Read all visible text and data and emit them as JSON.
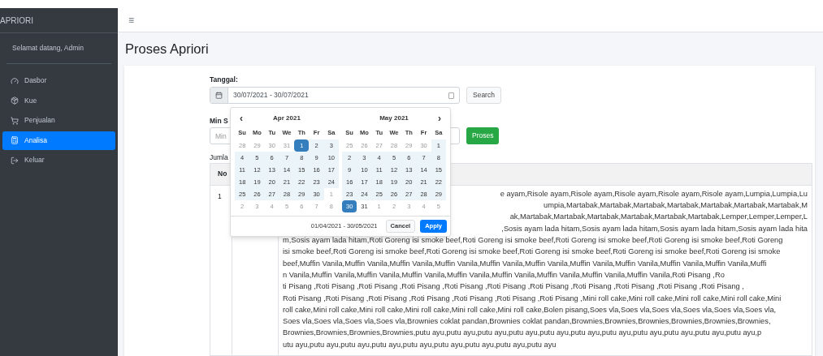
{
  "sidebar": {
    "brand": "APRIORI",
    "user": "Selamat datang, Admin",
    "items": [
      {
        "label": "Dasbor",
        "selected": false
      },
      {
        "label": "Kue",
        "selected": false
      },
      {
        "label": "Penjualan",
        "selected": false
      },
      {
        "label": "Analisa",
        "selected": true
      },
      {
        "label": "Keluar",
        "selected": false
      }
    ]
  },
  "navbar": {
    "menu": "≡"
  },
  "page_title": "Proses Apriori",
  "form": {
    "date_label": "Tanggal:",
    "date_value": "30/07/2021 - 30/07/2021",
    "search_button": "Search",
    "min_label": "Min S",
    "min_placeholder": "Min",
    "proses_button": "Proses",
    "count_label": "Jumla"
  },
  "datepicker": {
    "prev": "‹",
    "next": "›",
    "range_text": "01/04/2021 - 30/05/2021",
    "cancel": "Cancel",
    "apply": "Apply",
    "months": [
      {
        "title": "Apr 2021",
        "weekdays": [
          "Su",
          "Mo",
          "Tu",
          "We",
          "Th",
          "Fr",
          "Sa"
        ],
        "days": [
          {
            "d": "28",
            "off": true,
            "range": false,
            "selected": false
          },
          {
            "d": "29",
            "off": true,
            "range": false,
            "selected": false
          },
          {
            "d": "30",
            "off": true,
            "range": false,
            "selected": false
          },
          {
            "d": "31",
            "off": true,
            "range": false,
            "selected": false
          },
          {
            "d": "1",
            "off": false,
            "range": true,
            "selected": true
          },
          {
            "d": "2",
            "off": false,
            "range": true,
            "selected": false
          },
          {
            "d": "3",
            "off": false,
            "range": true,
            "selected": false
          },
          {
            "d": "4",
            "off": false,
            "range": true,
            "selected": false
          },
          {
            "d": "5",
            "off": false,
            "range": true,
            "selected": false
          },
          {
            "d": "6",
            "off": false,
            "range": true,
            "selected": false
          },
          {
            "d": "7",
            "off": false,
            "range": true,
            "selected": false
          },
          {
            "d": "8",
            "off": false,
            "range": true,
            "selected": false
          },
          {
            "d": "9",
            "off": false,
            "range": true,
            "selected": false
          },
          {
            "d": "10",
            "off": false,
            "range": true,
            "selected": false
          },
          {
            "d": "11",
            "off": false,
            "range": true,
            "selected": false
          },
          {
            "d": "12",
            "off": false,
            "range": true,
            "selected": false
          },
          {
            "d": "13",
            "off": false,
            "range": true,
            "selected": false
          },
          {
            "d": "14",
            "off": false,
            "range": true,
            "selected": false
          },
          {
            "d": "15",
            "off": false,
            "range": true,
            "selected": false
          },
          {
            "d": "16",
            "off": false,
            "range": true,
            "selected": false
          },
          {
            "d": "17",
            "off": false,
            "range": true,
            "selected": false
          },
          {
            "d": "18",
            "off": false,
            "range": true,
            "selected": false
          },
          {
            "d": "19",
            "off": false,
            "range": true,
            "selected": false
          },
          {
            "d": "20",
            "off": false,
            "range": true,
            "selected": false
          },
          {
            "d": "21",
            "off": false,
            "range": true,
            "selected": false
          },
          {
            "d": "22",
            "off": false,
            "range": true,
            "selected": false
          },
          {
            "d": "23",
            "off": false,
            "range": true,
            "selected": false
          },
          {
            "d": "24",
            "off": false,
            "range": true,
            "selected": false
          },
          {
            "d": "25",
            "off": false,
            "range": true,
            "selected": false
          },
          {
            "d": "26",
            "off": false,
            "range": true,
            "selected": false
          },
          {
            "d": "27",
            "off": false,
            "range": true,
            "selected": false
          },
          {
            "d": "28",
            "off": false,
            "range": true,
            "selected": false
          },
          {
            "d": "29",
            "off": false,
            "range": true,
            "selected": false
          },
          {
            "d": "30",
            "off": false,
            "range": true,
            "selected": false
          },
          {
            "d": "1",
            "off": true,
            "range": false,
            "selected": false
          },
          {
            "d": "2",
            "off": true,
            "range": false,
            "selected": false
          },
          {
            "d": "3",
            "off": true,
            "range": false,
            "selected": false
          },
          {
            "d": "4",
            "off": true,
            "range": false,
            "selected": false
          },
          {
            "d": "5",
            "off": true,
            "range": false,
            "selected": false
          },
          {
            "d": "6",
            "off": true,
            "range": false,
            "selected": false
          },
          {
            "d": "7",
            "off": true,
            "range": false,
            "selected": false
          },
          {
            "d": "8",
            "off": true,
            "range": false,
            "selected": false
          }
        ]
      },
      {
        "title": "May 2021",
        "weekdays": [
          "Su",
          "Mo",
          "Tu",
          "We",
          "Th",
          "Fr",
          "Sa"
        ],
        "days": [
          {
            "d": "25",
            "off": true,
            "range": false,
            "selected": false
          },
          {
            "d": "26",
            "off": true,
            "range": false,
            "selected": false
          },
          {
            "d": "27",
            "off": true,
            "range": false,
            "selected": false
          },
          {
            "d": "28",
            "off": true,
            "range": false,
            "selected": false
          },
          {
            "d": "29",
            "off": true,
            "range": false,
            "selected": false
          },
          {
            "d": "30",
            "off": true,
            "range": false,
            "selected": false
          },
          {
            "d": "1",
            "off": false,
            "range": true,
            "selected": false
          },
          {
            "d": "2",
            "off": false,
            "range": true,
            "selected": false
          },
          {
            "d": "3",
            "off": false,
            "range": true,
            "selected": false
          },
          {
            "d": "4",
            "off": false,
            "range": true,
            "selected": false
          },
          {
            "d": "5",
            "off": false,
            "range": true,
            "selected": false
          },
          {
            "d": "6",
            "off": false,
            "range": true,
            "selected": false
          },
          {
            "d": "7",
            "off": false,
            "range": true,
            "selected": false
          },
          {
            "d": "8",
            "off": false,
            "range": true,
            "selected": false
          },
          {
            "d": "9",
            "off": false,
            "range": true,
            "selected": false
          },
          {
            "d": "10",
            "off": false,
            "range": true,
            "selected": false
          },
          {
            "d": "11",
            "off": false,
            "range": true,
            "selected": false
          },
          {
            "d": "12",
            "off": false,
            "range": true,
            "selected": false
          },
          {
            "d": "13",
            "off": false,
            "range": true,
            "selected": false
          },
          {
            "d": "14",
            "off": false,
            "range": true,
            "selected": false
          },
          {
            "d": "15",
            "off": false,
            "range": true,
            "selected": false
          },
          {
            "d": "16",
            "off": false,
            "range": true,
            "selected": false
          },
          {
            "d": "17",
            "off": false,
            "range": true,
            "selected": false
          },
          {
            "d": "18",
            "off": false,
            "range": true,
            "selected": false
          },
          {
            "d": "19",
            "off": false,
            "range": true,
            "selected": false
          },
          {
            "d": "20",
            "off": false,
            "range": true,
            "selected": false
          },
          {
            "d": "21",
            "off": false,
            "range": true,
            "selected": false
          },
          {
            "d": "22",
            "off": false,
            "range": true,
            "selected": false
          },
          {
            "d": "23",
            "off": false,
            "range": true,
            "selected": false
          },
          {
            "d": "24",
            "off": false,
            "range": true,
            "selected": false
          },
          {
            "d": "25",
            "off": false,
            "range": true,
            "selected": false
          },
          {
            "d": "26",
            "off": false,
            "range": true,
            "selected": false
          },
          {
            "d": "27",
            "off": false,
            "range": true,
            "selected": false
          },
          {
            "d": "28",
            "off": false,
            "range": true,
            "selected": false
          },
          {
            "d": "29",
            "off": false,
            "range": true,
            "selected": false
          },
          {
            "d": "30",
            "off": false,
            "range": true,
            "selected": true
          },
          {
            "d": "31",
            "off": false,
            "range": false,
            "selected": false
          },
          {
            "d": "1",
            "off": true,
            "range": false,
            "selected": false
          },
          {
            "d": "2",
            "off": true,
            "range": false,
            "selected": false
          },
          {
            "d": "3",
            "off": true,
            "range": false,
            "selected": false
          },
          {
            "d": "4",
            "off": true,
            "range": false,
            "selected": false
          },
          {
            "d": "5",
            "off": true,
            "range": false,
            "selected": false
          }
        ]
      }
    ]
  },
  "table": {
    "columns": [
      "No"
    ],
    "rows": [
      {
        "no": "1",
        "items_lines": [
          "e ayam,Risole ayam,Risole ayam,Risole ayam,Risole ayam,Risole ayam,Lumpia,Lumpia,Lu",
          "umpia,Martabak,Martabak,Martabak,Martabak,Martabak,Martabak,Martabak,M",
          "ak,Martabak,Martabak,Martabak,Martabak,Martabak,Martabak,Lemper,Lemper,Lemper,L",
          ",Sosis ayam lada hitam,Sosis ayam lada hitam,Sosis ayam lada hitam,Sosis ayam lada hita",
          "m,Sosis ayam lada hitam,Roti Goreng isi smoke beef,Roti Goreng isi smoke beef,Roti Goreng isi smoke beef,Roti Goreng isi smoke beef,Roti Goreng",
          "isi smoke beef,Roti Goreng isi smoke beef,Roti Goreng isi smoke beef,Roti Goreng isi smoke beef,Roti Goreng isi smoke beef,Roti Goreng isi smoke",
          "beef,Muffin Vanila,Muffin Vanila,Muffin Vanila,Muffin Vanila,Muffin Vanila,Muffin Vanila,Muffin Vanila,Muffin Vanila,Muffin Vanila,Muffin Vanila,Muffi",
          "n Vanila,Muffin Vanila,Muffin Vanila,Muffin Vanila,Muffin Vanila,Muffin Vanila,Muffin Vanila,Muffin Vanila,Muffin Vanila,Roti Pisang ,Ro",
          "ti Pisang ,Roti Pisang ,Roti Pisang ,Roti Pisang ,Roti Pisang ,Roti Pisang ,Roti Pisang ,Roti Pisang ,Roti Pisang ,Roti Pisang ,Roti Pisang ,",
          "Roti Pisang ,Roti Pisang ,Roti Pisang ,Roti Pisang ,Roti Pisang ,Roti Pisang ,Roti Pisang ,Mini roll cake,Mini roll cake,Mini roll cake,Mini roll cake,Mini",
          "roll cake,Mini roll cake,Mini roll cake,Mini roll cake,Mini roll cake,Mini roll cake,Bolen pisang,Soes vla,Soes vla,Soes vla,Soes vla,Soes vla,Soes vla,",
          "Soes vla,Soes vla,Soes vla,Soes vla,Brownies coklat pandan,Brownies coklat pandan,Brownies,Brownies,Brownies,Brownies,Brownies,Brownies,",
          "Brownies,Brownies,Brownies,Brownies,putu ayu,putu ayu,putu ayu,putu ayu,putu ayu,putu ayu,putu ayu,putu ayu,putu ayu,putu ayu,putu ayu,p",
          "utu ayu,putu ayu,putu ayu,putu ayu,putu ayu,putu ayu,putu ayu,putu ayu,putu ayu"
        ]
      }
    ]
  }
}
